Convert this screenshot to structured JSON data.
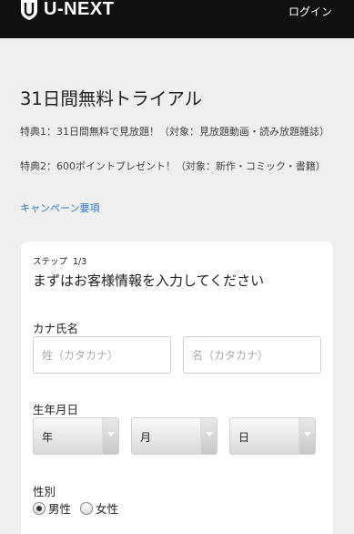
{
  "header": {
    "brand": "U-NEXT",
    "login_label": "ログイン"
  },
  "page": {
    "title": "31日間無料トライアル",
    "benefits": [
      "特典1：31日間無料で見放題！（対象：見放題動画・読み放題雑誌）",
      "特典2：600ポイントプレゼント！（対象：新作・コミック・書籍）"
    ],
    "campaign_link": "キャンペーン要項"
  },
  "form": {
    "step_label": "ステップ",
    "step_value": "1/3",
    "title": "まずはお客様情報を入力してください",
    "kana_label": "カナ氏名",
    "sei_placeholder": "姓（カタカナ）",
    "mei_placeholder": "名（カタカナ）",
    "birth_label": "生年月日",
    "year_value": "年",
    "month_value": "月",
    "day_value": "日",
    "gender_label": "性別",
    "gender_options": [
      "男性",
      "女性"
    ],
    "gender_selected": "男性"
  },
  "colors": {
    "header_bg": "#111111",
    "page_bg": "#efefef",
    "link": "#2e7ad1"
  }
}
